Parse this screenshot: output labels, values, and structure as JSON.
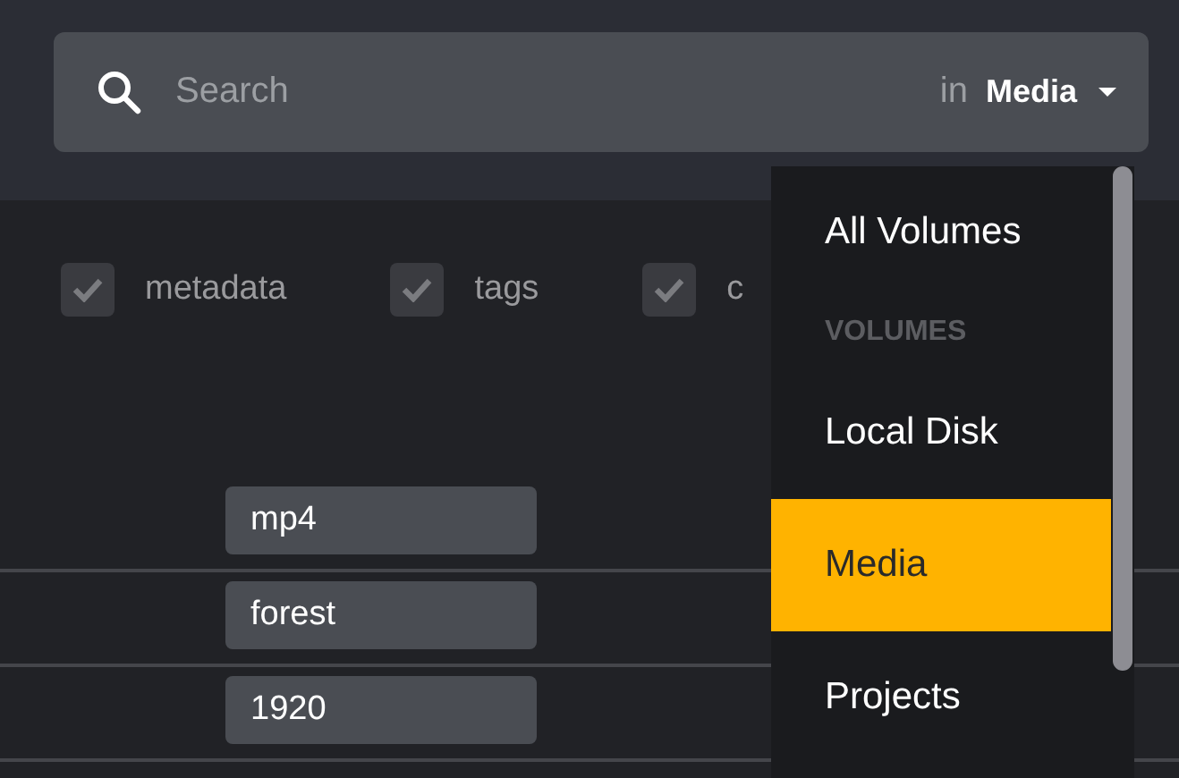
{
  "search": {
    "placeholder": "Search",
    "scope_prefix": "in",
    "scope": "Media"
  },
  "filters": [
    {
      "label": "metadata",
      "checked": true
    },
    {
      "label": "tags",
      "checked": true
    },
    {
      "label": "c",
      "checked": true
    }
  ],
  "fields": [
    {
      "value": "mp4"
    },
    {
      "value": "forest"
    },
    {
      "value": "1920"
    }
  ],
  "menu": {
    "items": [
      {
        "kind": "option",
        "label": "All Volumes",
        "selected": false
      },
      {
        "kind": "header",
        "label": "VOLUMES"
      },
      {
        "kind": "option",
        "label": "Local Disk",
        "selected": false
      },
      {
        "kind": "option",
        "label": "Media",
        "selected": true
      },
      {
        "kind": "option",
        "label": "Projects",
        "selected": false
      }
    ]
  }
}
